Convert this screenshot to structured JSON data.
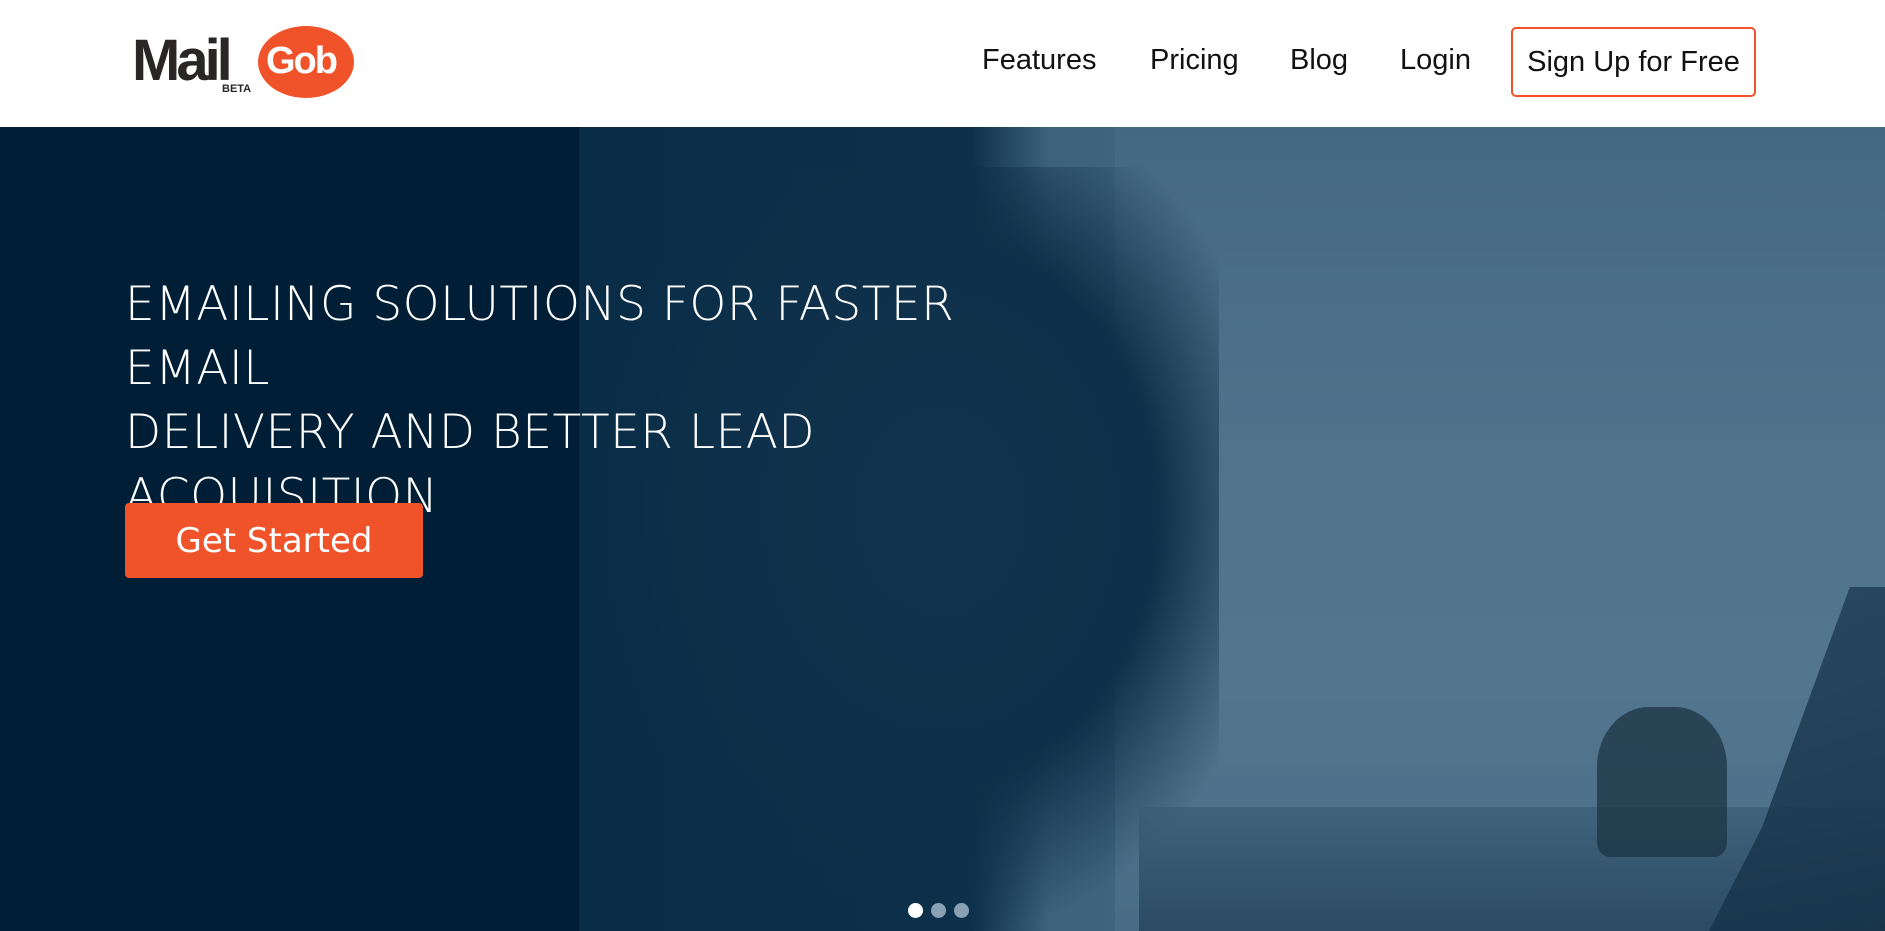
{
  "header": {
    "logo": {
      "mail": "Mail",
      "gob": "Gob",
      "beta": "BETA"
    },
    "nav": {
      "features": "Features",
      "pricing": "Pricing",
      "blog": "Blog",
      "login": "Login",
      "signup": "Sign Up for Free"
    }
  },
  "hero": {
    "title_line1": "EMAILING SOLUTIONS FOR FASTER EMAIL",
    "title_line2": "DELIVERY AND BETTER LEAD ACQUISITION",
    "cta_label": "Get Started",
    "carousel": {
      "slide_count": 3,
      "active_index": 0
    }
  },
  "colors": {
    "accent": "#f0532a",
    "hero_background": "#001f36",
    "text_dark": "#111111",
    "white": "#ffffff"
  }
}
